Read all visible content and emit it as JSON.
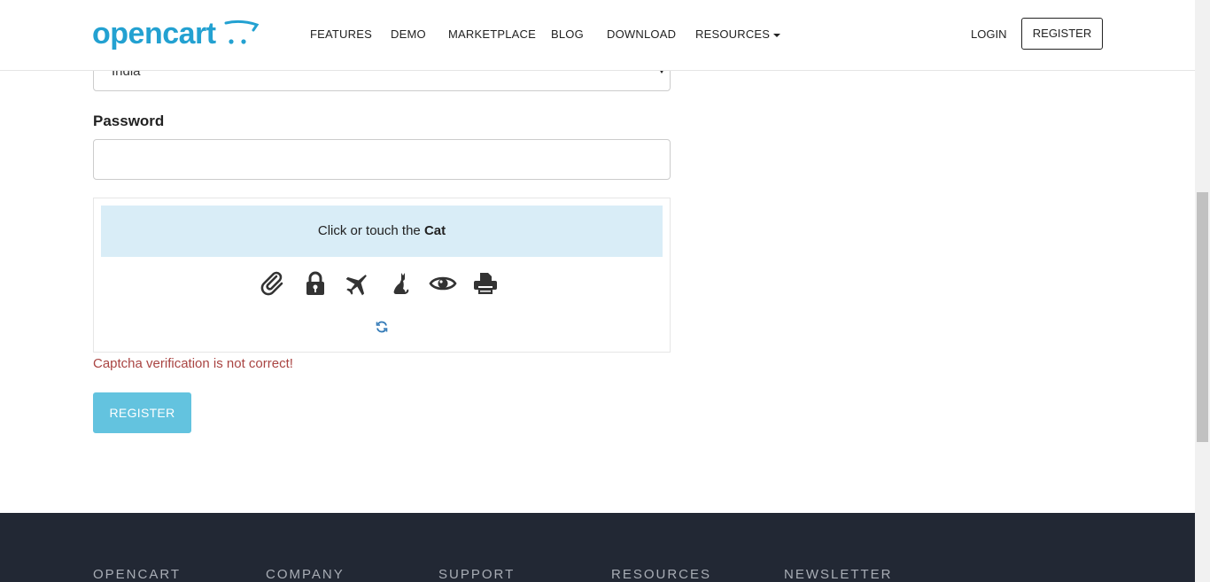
{
  "header": {
    "logo_text": "opencart",
    "nav": [
      "FEATURES",
      "DEMO",
      "MARKETPLACE",
      "BLOG",
      "DOWNLOAD",
      "RESOURCES"
    ],
    "login_label": "LOGIN",
    "register_label": "REGISTER"
  },
  "form": {
    "country_value": "India",
    "password_label": "Password",
    "password_value": "",
    "captcha": {
      "prompt_prefix": "Click or touch the ",
      "prompt_target": "Cat",
      "icons": [
        "paperclip-icon",
        "lock-icon",
        "airplane-icon",
        "cat-icon",
        "eye-icon",
        "printer-icon"
      ],
      "refresh_icon": "refresh-icon"
    },
    "error_message": "Captcha verification is not correct!",
    "submit_label": "REGISTER"
  },
  "footer": {
    "columns": [
      "OPENCART",
      "COMPANY",
      "SUPPORT",
      "RESOURCES",
      "NEWSLETTER"
    ]
  },
  "colors": {
    "brand": "#23a1d1",
    "captcha_bg": "#d9edf7",
    "error": "#a94442",
    "submit": "#5bc0de",
    "footer_bg": "#222834"
  }
}
